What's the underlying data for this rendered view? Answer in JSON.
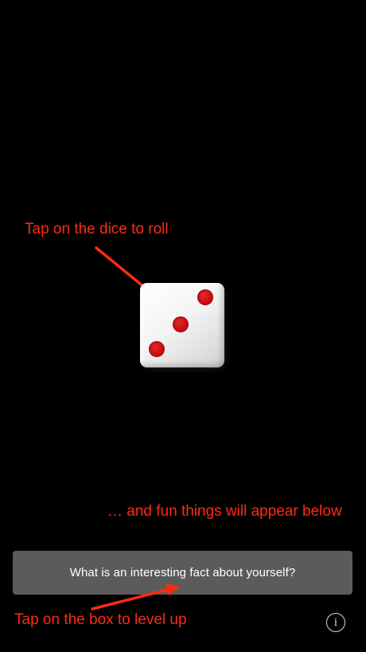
{
  "hints": {
    "dice": "Tap on the dice to roll",
    "below": "… and fun things will appear below",
    "box": "Tap on the box to level up"
  },
  "dice": {
    "face_value": 3,
    "pip_color": "#c40c10"
  },
  "level_box": {
    "text": "What is an interesting fact about yourself?"
  },
  "info_button": {
    "icon": "info-icon",
    "glyph": "i"
  },
  "colors": {
    "background": "#000000",
    "hint_text": "#ff2a12",
    "box_background": "#5b5b5b"
  }
}
